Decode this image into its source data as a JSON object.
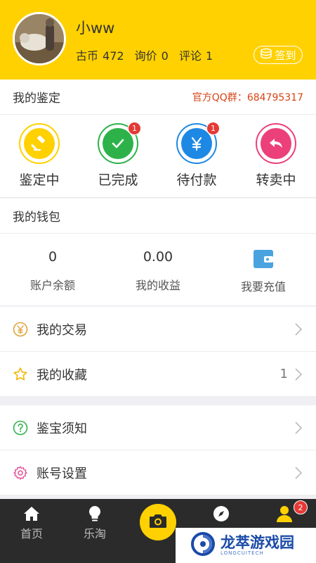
{
  "profile": {
    "username": "小ww",
    "coins_label": "古币",
    "coins_value": "472",
    "inquiry_label": "询价",
    "inquiry_value": "0",
    "review_label": "评论",
    "review_value": "1",
    "signin_label": "签到"
  },
  "appraisal": {
    "title": "我的鉴定",
    "qq_text": "官方QQ群：684795317",
    "items": [
      {
        "label": "鉴定中",
        "icon": "gavel-icon",
        "color": "#ffd100",
        "badge": ""
      },
      {
        "label": "已完成",
        "icon": "check-icon",
        "color": "#2db24a",
        "badge": "1"
      },
      {
        "label": "待付款",
        "icon": "yen-icon",
        "color": "#1e88e5",
        "badge": "1"
      },
      {
        "label": "转卖中",
        "icon": "reply-icon",
        "color": "#ec407a",
        "badge": ""
      }
    ]
  },
  "wallet": {
    "title": "我的钱包",
    "balance_value": "0",
    "balance_label": "账户余额",
    "earnings_value": "0.00",
    "earnings_label": "我的收益",
    "recharge_label": "我要充值"
  },
  "menu": {
    "trades": "我的交易",
    "favorites": "我的收藏",
    "favorites_count": "1",
    "guide": "鉴宝须知",
    "settings": "账号设置"
  },
  "tabs": {
    "home": "首页",
    "market": "乐淘",
    "badge": "2"
  },
  "watermark": {
    "name": "龙萃游戏园",
    "sub": "LONGCUITECH"
  },
  "colors": {
    "brand": "#ffd100",
    "qq": "#d84315",
    "badge": "#e53935"
  }
}
